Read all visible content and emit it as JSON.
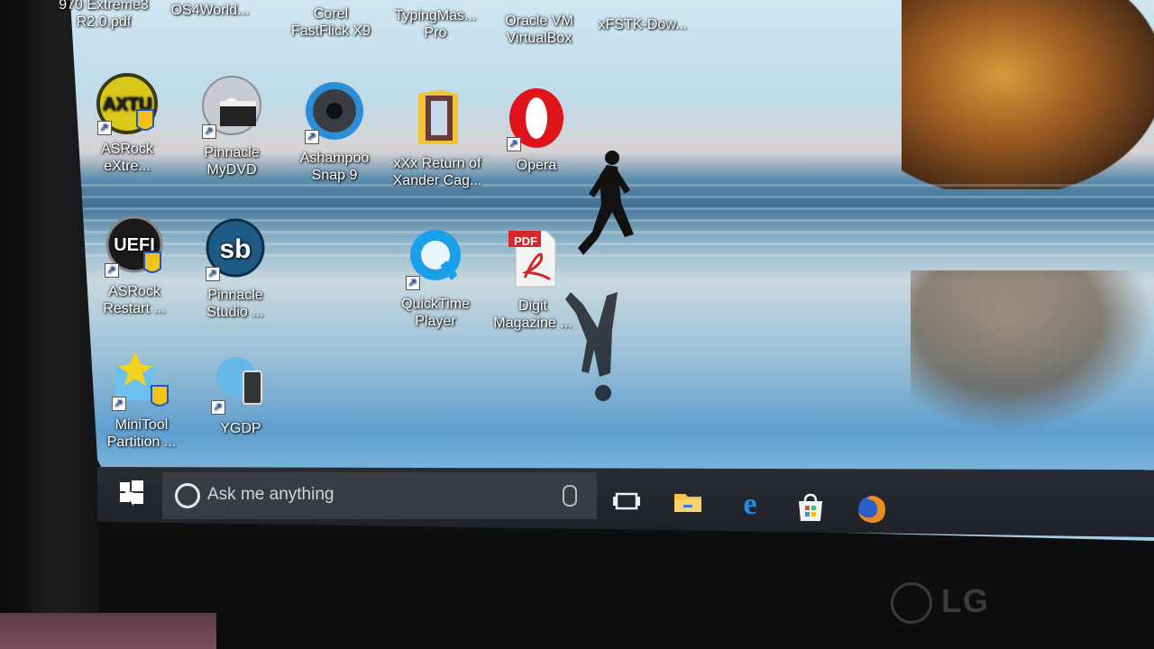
{
  "desktop": {
    "top_row": [
      {
        "label": "970 Extreme3\nR2.0.pdf"
      },
      {
        "label": "OS4World..."
      },
      {
        "label": "Corel\nFastFlick X9"
      },
      {
        "label": "TypingMas...\nPro"
      },
      {
        "label": "Oracle VM\nVirtualBox"
      },
      {
        "label": "xFSTK-Dow..."
      }
    ],
    "icons": [
      {
        "label": "ASRock\neXtre...",
        "icon": "asrock-axtu-icon"
      },
      {
        "label": "Pinnacle\nMyDVD",
        "icon": "pinnacle-mydvd-icon"
      },
      {
        "label": "Ashampoo\nSnap 9",
        "icon": "ashampoo-snap-icon"
      },
      {
        "label": "xXx Return of\nXander Cag...",
        "icon": "movie-folder-icon"
      },
      {
        "label": "Opera",
        "icon": "opera-icon"
      },
      {
        "label": "ASRock\nRestart ...",
        "icon": "asrock-uefi-icon"
      },
      {
        "label": "Pinnacle\nStudio ...",
        "icon": "pinnacle-studio-icon"
      },
      {
        "label": "QuickTime\nPlayer",
        "icon": "quicktime-icon"
      },
      {
        "label": "Digit\nMagazine ...",
        "icon": "pdf-file-icon",
        "badge": "PDF"
      },
      {
        "label": "MiniTool\nPartition ...",
        "icon": "minitool-icon"
      },
      {
        "label": "YGDP",
        "icon": "ygdp-icon"
      }
    ]
  },
  "taskbar": {
    "search_placeholder": "Ask me anything",
    "pinned": [
      "task-view-icon",
      "file-explorer-icon",
      "edge-icon",
      "store-icon",
      "firefox-icon"
    ]
  },
  "monitor": {
    "brand": "LG"
  },
  "colors": {
    "taskbar": "#1f2128",
    "search": "#3a3c44",
    "opera": "#e0121a",
    "pdf": "#d8252a"
  }
}
